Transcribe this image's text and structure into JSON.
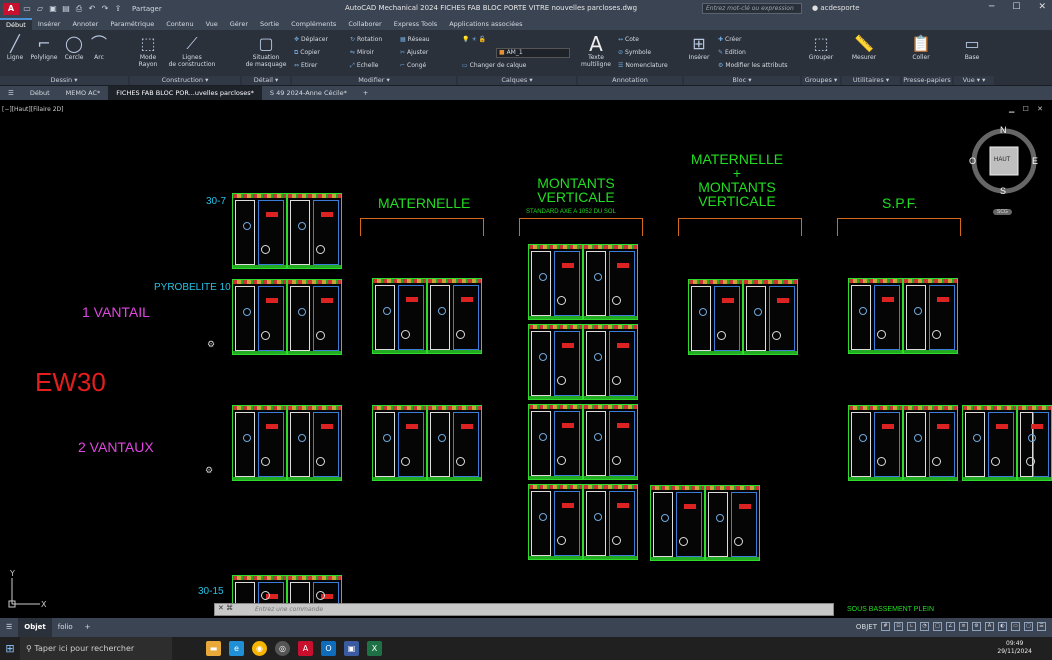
{
  "app": {
    "logo_text": "A",
    "share_label": "Partager",
    "window_title": "AutoCAD Mechanical 2024   FICHES FAB BLOC PORTE VITRE nouvelles parcloses.dwg",
    "search_placeholder": "Entrez mot-clé ou expression",
    "user": "acdesporte"
  },
  "ribbon_tabs": [
    "Début",
    "Insérer",
    "Annoter",
    "Paramétrique",
    "Contenu",
    "Vue",
    "Gérer",
    "Sortie",
    "Compléments",
    "Collaborer",
    "Express Tools",
    "Applications associées"
  ],
  "ribbon": {
    "dessin": {
      "title": "Dessin ▾",
      "ligne": "Ligne",
      "polyligne": "Polyligne",
      "cercle": "Cercle",
      "arc": "Arc"
    },
    "construction": {
      "title": "Construction ▾",
      "mode_rayon": "Mode\nRayon",
      "lignes": "Lignes\nde construction"
    },
    "detail": {
      "title": "Détail ▾",
      "situation": "Situation\nde masquage"
    },
    "modifier": {
      "title": "Modifier ▾",
      "deplacer": "Déplacer",
      "copier": "Copier",
      "etirer": "Etirer",
      "rotation": "Rotation",
      "miroir": "Miroir",
      "echelle": "Echelle",
      "reseau": "Réseau",
      "ajuster": "Ajuster",
      "conge": "Congé"
    },
    "calques": {
      "title": "Calques ▾",
      "layer": "AM_1",
      "changer": "Changer de calque"
    },
    "annotation": {
      "title": "Annotation",
      "texte": "Texte\nmultiligne",
      "cote": "Cote",
      "symbole": "Symbole",
      "nomenclature": "Nomenclature"
    },
    "bloc": {
      "title": "Bloc ▾",
      "inserer": "Insérer",
      "creer": "Créer",
      "edition": "Edition",
      "modifier_attr": "Modifier les attributs"
    },
    "groupes": {
      "title": "Groupes ▾",
      "grouper": "Grouper"
    },
    "utilitaires": {
      "title": "Utilitaires ▾",
      "mesurer": "Mesurer"
    },
    "presse": {
      "title": "Presse-papiers",
      "coller": "Coller"
    },
    "vue": {
      "title": "Vue ▾ ▾",
      "base": "Base"
    }
  },
  "doc_tabs": [
    "Début",
    "MEMO AC*",
    "FICHES FAB BLOC POR...uvelles parcloses*",
    "S 49 2024-Anne Cécile*"
  ],
  "viewport": {
    "label": "[−][Haut][Filaire 2D]",
    "labels": {
      "t30_7": "30-7",
      "pyrobelite": "PYROBELITE 10",
      "un_vantail": "1 VANTAIL",
      "ew30": "EW30",
      "deux_vantaux": "2 VANTAUX",
      "t30_15": "30-15",
      "maternelle": "MATERNELLE",
      "montants": "MONTANTS\nVERTICALE",
      "standard": "STANDARD AXE A 1052 DU SOL",
      "mat_montants": "MATERNELLE\n+\nMONTANTS\nVERTICALE",
      "spf": "S.P.F.",
      "sous_bassement": "SOUS BASSEMENT PLEIN"
    },
    "viewcube": {
      "n": "N",
      "s": "S",
      "e": "E",
      "o": "O",
      "face": "HAUT",
      "ucs": "SCG"
    }
  },
  "command_line": {
    "placeholder": "Entrez une commande"
  },
  "layout_tabs": [
    "Objet",
    "folio"
  ],
  "status": {
    "objet": "OBJET"
  },
  "taskbar": {
    "search": "Taper ici pour rechercher",
    "time": "09:49",
    "date": "29/11/2024"
  }
}
